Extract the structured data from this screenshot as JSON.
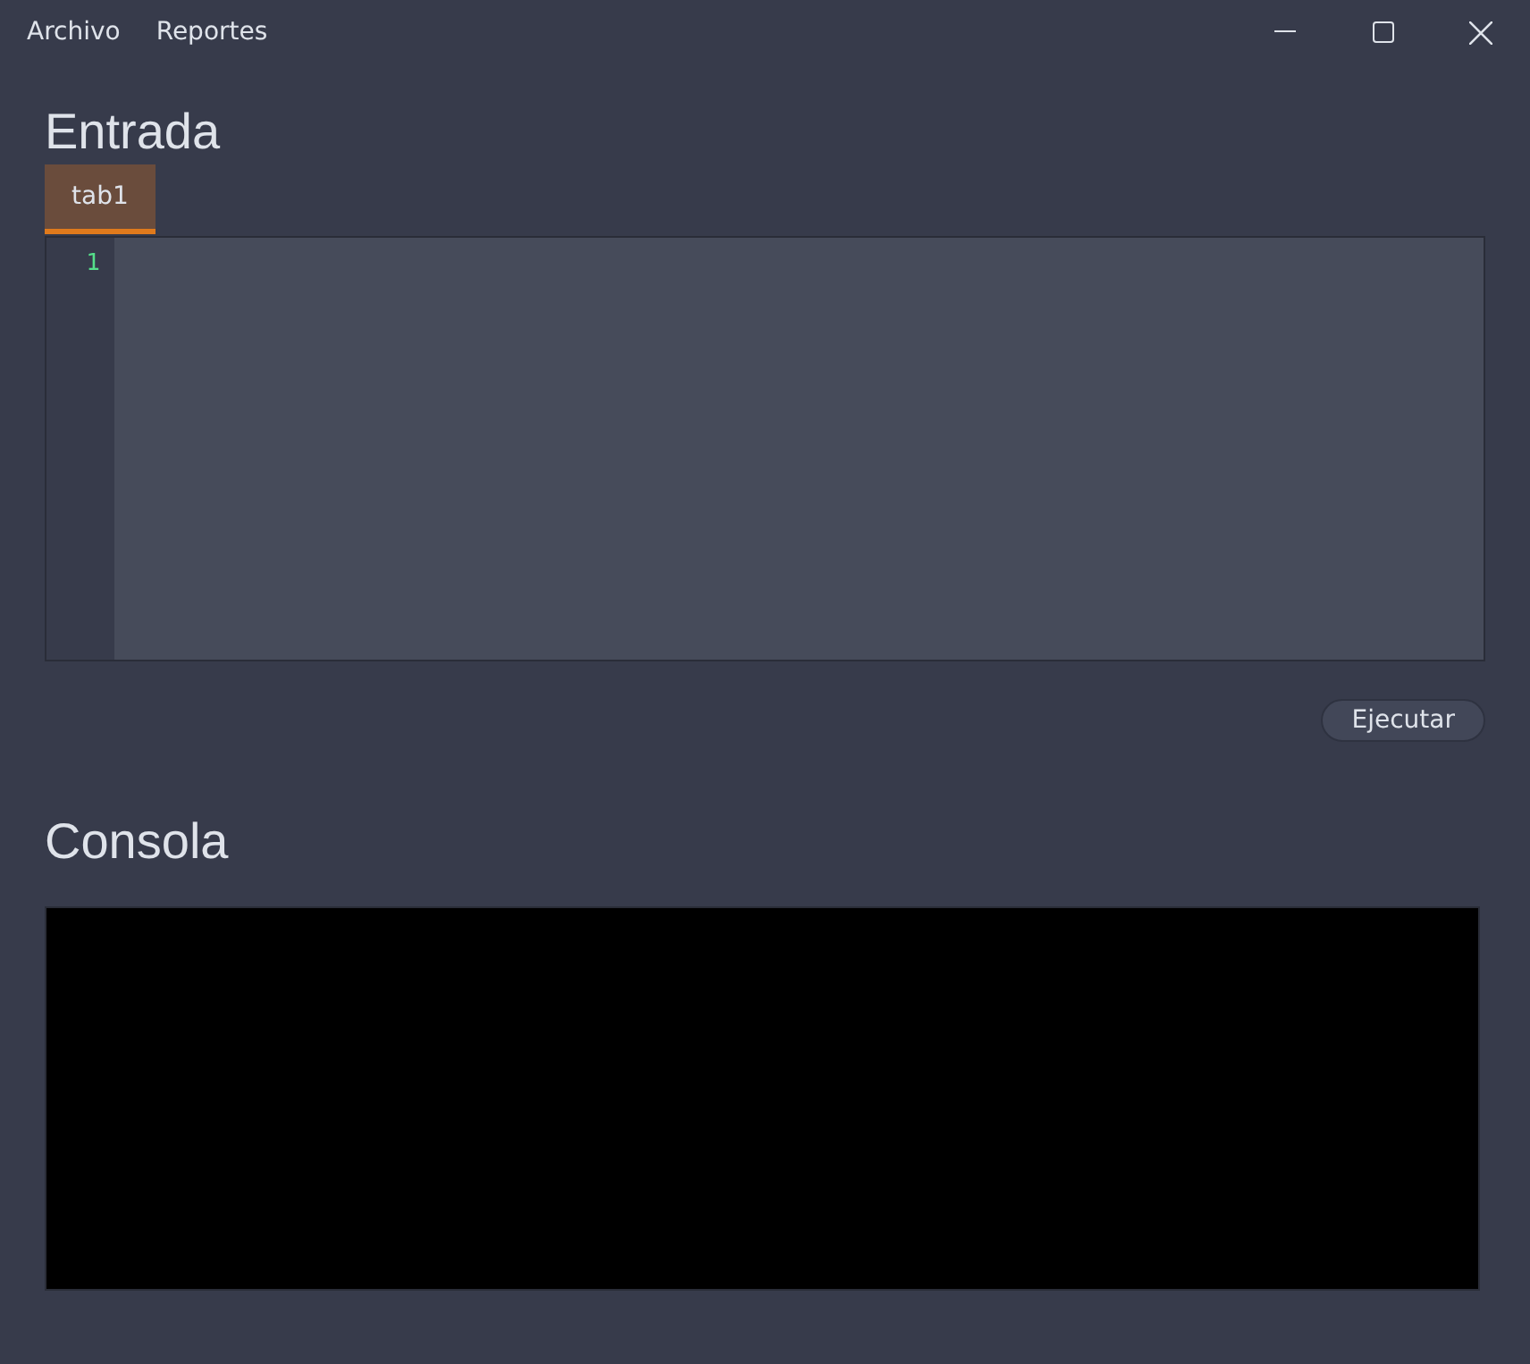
{
  "menu": [
    {
      "label": "Archivo"
    },
    {
      "label": "Reportes"
    }
  ],
  "input": {
    "title": "Entrada",
    "tabs": [
      {
        "label": "tab1",
        "selected": true
      }
    ],
    "line_numbers": [
      "1"
    ]
  },
  "run_button": {
    "label": "Ejecutar"
  },
  "console": {
    "title": "Consola"
  }
}
